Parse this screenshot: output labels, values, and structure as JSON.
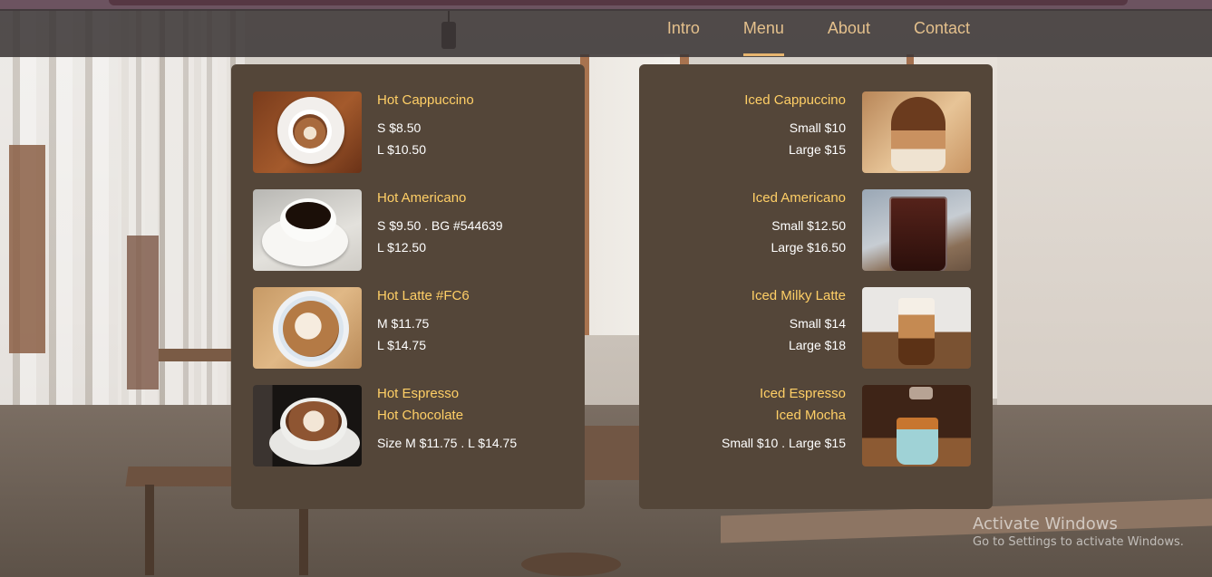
{
  "nav": {
    "items": [
      {
        "label": "Intro"
      },
      {
        "label": "Menu"
      },
      {
        "label": "About"
      },
      {
        "label": "Contact"
      }
    ],
    "active": "Menu"
  },
  "colors": {
    "card_bg": "#544639",
    "name_color": "#ffcf66",
    "accent": "#e7b56f",
    "nav_text": "#e4c08c"
  },
  "menu": {
    "hot": [
      {
        "name": "Hot Cappuccino",
        "prices": [
          "S $8.50",
          "L $10.50"
        ],
        "image": "hot-cappuccino-photo"
      },
      {
        "name": "Hot Americano",
        "prices": [
          "S $9.50 . BG #544639",
          "L $12.50"
        ],
        "image": "hot-americano-photo"
      },
      {
        "name": "Hot Latte #FC6",
        "prices": [
          "M $11.75",
          "L $14.75"
        ],
        "image": "hot-latte-photo"
      },
      {
        "names": [
          "Hot Espresso",
          "Hot Chocolate"
        ],
        "prices": [
          "Size M $11.75 . L $14.75"
        ],
        "image": "hot-espresso-photo"
      }
    ],
    "iced": [
      {
        "name": "Iced Cappuccino",
        "prices": [
          "Small $10",
          "Large $15"
        ],
        "image": "iced-cappuccino-photo"
      },
      {
        "name": "Iced Americano",
        "prices": [
          "Small $12.50",
          "Large $16.50"
        ],
        "image": "iced-americano-photo"
      },
      {
        "name": "Iced Milky Latte",
        "prices": [
          "Small $14",
          "Large $18"
        ],
        "image": "iced-milky-latte-photo"
      },
      {
        "names": [
          "Iced Espresso",
          "Iced Mocha"
        ],
        "prices": [
          "Small $10 . Large $15"
        ],
        "image": "iced-espresso-photo"
      }
    ]
  },
  "watermark": {
    "line1": "Activate Windows",
    "line2": "Go to Settings to activate Windows."
  }
}
